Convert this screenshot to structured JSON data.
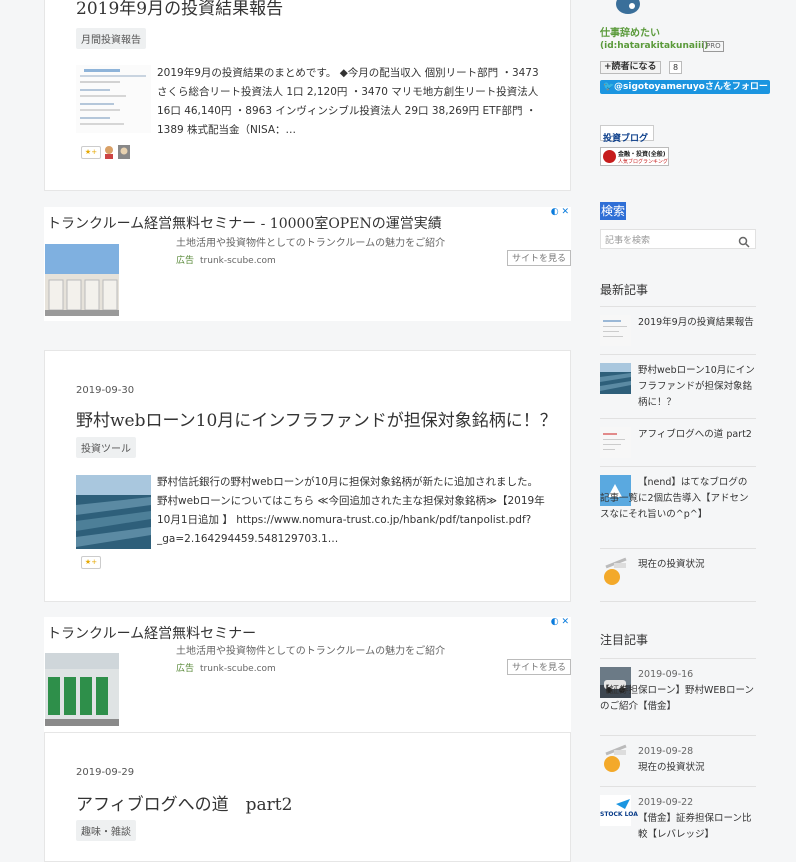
{
  "main": {
    "post1": {
      "title": "2019年9月の投資結果報告",
      "category": "月間投資報告",
      "excerpt": "2019年9月の投資結果のまとめです。 ◆今月の配当収入 個別リート部門 ・3473 さくら総合リート投資法人 1口 2,120円 ・3470 マリモ地方創生リート投資法人 16口 46,140円 ・8963 インヴィンシブル投資法人 29口 38,269円 ETF部門 ・1389 株式配当金（NISA：…",
      "star": "★+"
    },
    "ad1": {
      "title": "トランクルーム経営無料セミナー - 10000室OPENの運営実績",
      "subtitle": "土地活用や投資物件としてのトランクルームの魅力をご紹介",
      "ad_tag": "広告",
      "url": "trunk-scube.com",
      "button": "サイトを見る",
      "corner": "◐ ✕"
    },
    "post2": {
      "date": "2019-09-30",
      "title": "野村webローン10月にインフラファンドが担保対象銘柄に！？",
      "category": "投資ツール",
      "excerpt": "野村信託銀行の野村webローンが10月に担保対象銘柄が新たに追加されました。 野村webローンについてはこちら ≪今回追加された主な担保対象銘柄≫【2019年10月1日追加 】 https://www.nomura-trust.co.jp/hbank/pdf/tanpolist.pdf?_ga=2.164294459.548129703.1…",
      "star": "★+"
    },
    "ad2": {
      "title": "トランクルーム経営無料セミナー",
      "subtitle": "土地活用や投資物件としてのトランクルームの魅力をご紹介",
      "ad_tag": "広告",
      "url": "trunk-scube.com",
      "button": "サイトを見る",
      "corner": "◐ ✕"
    },
    "post3": {
      "date": "2019-09-29",
      "title": "アフィブログへの道　part2",
      "category": "趣味・雑談"
    }
  },
  "sidebar": {
    "profile_name": "仕事辞めたい",
    "profile_id": "(id:hatarakitakunaiii)",
    "pro_badge": "PRO",
    "reader_button": "+読者になる",
    "reader_count": "8",
    "twitter_follow": "@sigotoyameruyoさんをフォロー",
    "banner1": "投資ブログ",
    "banner2_top": "金融・投資(全般)",
    "banner2_bottom": "人気ブログランキング",
    "search_heading": "検索",
    "search_placeholder": "記事を検索",
    "recent_heading": "最新記事",
    "recent": [
      "2019年9月の投資結果報告",
      "野村webローン10月にインフラファンドが担保対象銘柄に！？",
      "アフィブログへの道 part2",
      "【nend】はてなブログの記事一覧に2個広告導入【アドセンスなにそれ旨いの^p^】",
      "現在の投資状況"
    ],
    "featured_heading": "注目記事",
    "featured": [
      {
        "date": "2019-09-16",
        "title": "【証券担保ローン】野村WEBローンのご紹介【借金】"
      },
      {
        "date": "2019-09-28",
        "title": "現在の投資状況"
      },
      {
        "date": "2019-09-22",
        "title": "【借金】証券担保ローン比較【レバレッジ】"
      }
    ],
    "stock_logo": "STOCK LOA"
  }
}
